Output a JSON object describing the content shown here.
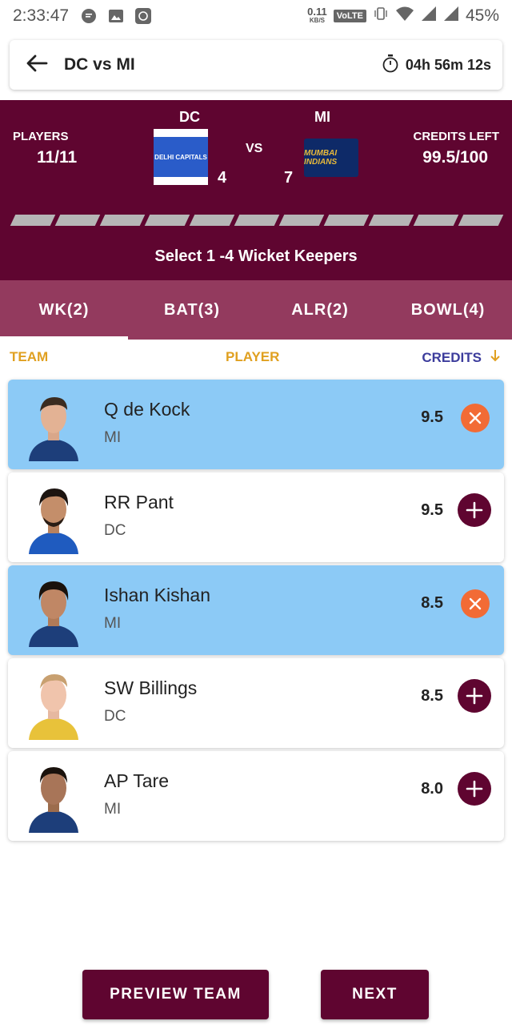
{
  "status_bar": {
    "time": "2:33:47",
    "net_speed": "0.11",
    "net_unit": "KB/S",
    "volte": "VoLTE",
    "battery": "45%"
  },
  "top_bar": {
    "title": "DC vs MI",
    "timer": "04h 56m 12s"
  },
  "match_header": {
    "players_label": "PLAYERS",
    "players_value": "11/11",
    "credits_label": "CREDITS LEFT",
    "credits_value": "99.5/100",
    "team1": {
      "name": "DC",
      "count": "4",
      "logo_text": "DELHI CAPITALS",
      "color": "#2a5cc9"
    },
    "team2": {
      "name": "MI",
      "count": "7",
      "logo_text": "MUMBAI INDIANS",
      "color": "#0e2a68"
    },
    "vs": "VS",
    "progress_filled": 11,
    "progress_total": 11,
    "instruction": "Select 1 -4 Wicket Keepers"
  },
  "tabs": [
    {
      "label": "WK(2)",
      "active": true
    },
    {
      "label": "BAT(3)",
      "active": false
    },
    {
      "label": "ALR(2)",
      "active": false
    },
    {
      "label": "BOWL(4)",
      "active": false
    }
  ],
  "columns": {
    "team": "TEAM",
    "player": "PLAYER",
    "credits": "CREDITS",
    "sort_icon": "arrow-down-icon"
  },
  "players": [
    {
      "name": "Q de Kock",
      "team": "MI",
      "credits": "9.5",
      "selected": true
    },
    {
      "name": "RR Pant",
      "team": "DC",
      "credits": "9.5",
      "selected": false
    },
    {
      "name": "Ishan Kishan",
      "team": "MI",
      "credits": "8.5",
      "selected": true
    },
    {
      "name": "SW Billings",
      "team": "DC",
      "credits": "8.5",
      "selected": false
    },
    {
      "name": "AP Tare",
      "team": "MI",
      "credits": "8.0",
      "selected": false
    }
  ],
  "buttons": {
    "preview": "PREVIEW TEAM",
    "next": "NEXT"
  },
  "colors": {
    "primary": "#5f0530",
    "tab_bar": "#933a5e",
    "selected_row": "#8ccaf6",
    "remove": "#f26b35",
    "accent": "#e0a020"
  }
}
